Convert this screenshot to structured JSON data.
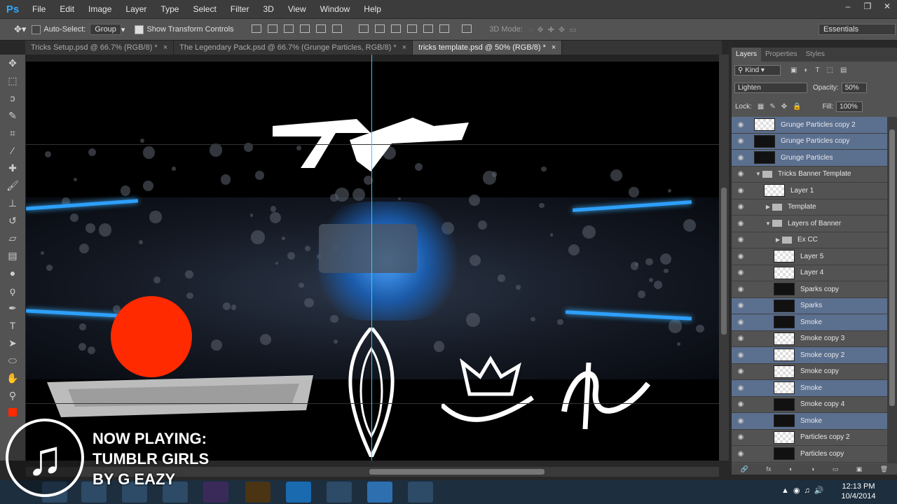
{
  "app": {
    "logo": "Ps"
  },
  "menu": [
    "File",
    "Edit",
    "Image",
    "Layer",
    "Type",
    "Select",
    "Filter",
    "3D",
    "View",
    "Window",
    "Help"
  ],
  "window_buttons": {
    "minimize": "–",
    "restore": "❐",
    "close": "✕"
  },
  "options_bar": {
    "auto_select_label": "Auto-Select:",
    "auto_select_value": "Group",
    "transform_label": "Show Transform Controls",
    "mode_label": "3D Mode:",
    "workspace": "Essentials"
  },
  "tabs": [
    {
      "label": "Tricks Setup.psd @ 66.7% (RGB/8) *",
      "close": "×",
      "active": false
    },
    {
      "label": "The Legendary Pack.psd @ 66.7% (Grunge Particles, RGB/8) *",
      "close": "×",
      "active": false
    },
    {
      "label": "tricks template.psd @ 50% (RGB/8) *",
      "close": "×",
      "active": true
    }
  ],
  "panel": {
    "tabs": [
      "Layers",
      "Properties",
      "Styles"
    ],
    "filter_kind": "Kind",
    "blend_mode": "Lighten",
    "opacity_label": "Opacity:",
    "opacity_value": "50%",
    "lock_label": "Lock:",
    "fill_label": "Fill:",
    "fill_value": "100%"
  },
  "layers": [
    {
      "name": "Grunge Particles copy 2",
      "selected": true,
      "type": "layer",
      "dark": false,
      "indent": 0
    },
    {
      "name": "Grunge Particles copy",
      "selected": true,
      "type": "layer",
      "dark": true,
      "indent": 0
    },
    {
      "name": "Grunge Particles",
      "selected": true,
      "type": "layer",
      "dark": true,
      "indent": 0
    },
    {
      "name": "Tricks Banner Template",
      "selected": false,
      "type": "group-open",
      "indent": 0
    },
    {
      "name": "Layer 1",
      "selected": false,
      "type": "layer",
      "dark": false,
      "indent": 1
    },
    {
      "name": "Template",
      "selected": false,
      "type": "group-closed",
      "indent": 1
    },
    {
      "name": "Layers of Banner",
      "selected": false,
      "type": "group-open",
      "indent": 1
    },
    {
      "name": "Ex CC",
      "selected": false,
      "type": "group-closed",
      "indent": 2
    },
    {
      "name": "Layer 5",
      "selected": false,
      "type": "layer",
      "dark": false,
      "indent": 2
    },
    {
      "name": "Layer 4",
      "selected": false,
      "type": "layer",
      "dark": false,
      "indent": 2
    },
    {
      "name": "Sparks copy",
      "selected": false,
      "type": "layer",
      "dark": true,
      "indent": 2
    },
    {
      "name": "Sparks",
      "selected": true,
      "type": "layer",
      "dark": true,
      "indent": 2
    },
    {
      "name": "Smoke",
      "selected": true,
      "type": "layer",
      "dark": true,
      "indent": 2
    },
    {
      "name": "Smoke copy 3",
      "selected": false,
      "type": "layer",
      "dark": false,
      "indent": 2
    },
    {
      "name": "Smoke copy 2",
      "selected": true,
      "type": "layer",
      "dark": false,
      "indent": 2
    },
    {
      "name": "Smoke copy",
      "selected": false,
      "type": "layer",
      "dark": false,
      "indent": 2
    },
    {
      "name": "Smoke",
      "selected": true,
      "type": "layer",
      "dark": false,
      "indent": 2
    },
    {
      "name": "Smoke copy 4",
      "selected": false,
      "type": "layer",
      "dark": true,
      "indent": 2
    },
    {
      "name": "Smoke",
      "selected": true,
      "type": "layer",
      "dark": true,
      "indent": 2
    },
    {
      "name": "Particles copy 2",
      "selected": false,
      "type": "layer",
      "dark": false,
      "indent": 2
    },
    {
      "name": "Particles copy",
      "selected": false,
      "type": "layer",
      "dark": true,
      "indent": 2
    }
  ],
  "panel_footer": [
    "🔗",
    "fx",
    "◐",
    "◑",
    "▭",
    "▣",
    "🗑"
  ],
  "overlay": {
    "line1": "NOW PLAYING:",
    "line2": "TUMBLR GIRLS",
    "line3": "BY G EAZY"
  },
  "taskbar": {
    "time": "12:13 PM",
    "date": "10/4/2014"
  },
  "colors": {
    "accent": "#31a8ff",
    "guide": "#25d2ff",
    "selection": "#5b6f8f",
    "red": "#ff2a00"
  }
}
